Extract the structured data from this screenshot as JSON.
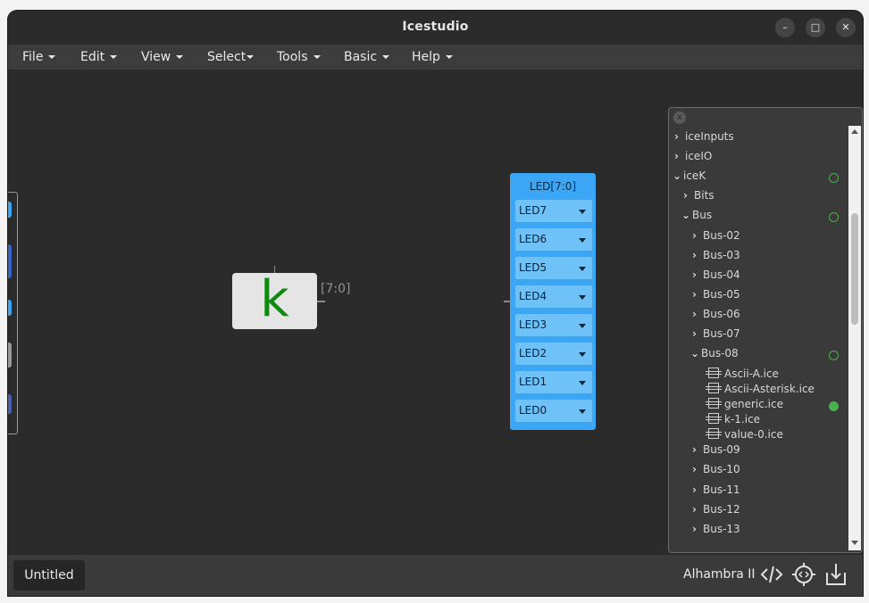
{
  "window": {
    "title": "Icestudio",
    "minimize": "–",
    "maximize": "□",
    "close": "✕"
  },
  "menubar": [
    {
      "label": "File"
    },
    {
      "label": "Edit"
    },
    {
      "label": "View"
    },
    {
      "label": "Select"
    },
    {
      "label": "Tools"
    },
    {
      "label": "Basic"
    },
    {
      "label": "Help"
    }
  ],
  "canvas": {
    "constant_block": {
      "value": "k",
      "port_label": "[7:0]"
    },
    "led_block": {
      "title": "LED[7:0]",
      "pins": [
        "LED7",
        "LED6",
        "LED5",
        "LED4",
        "LED3",
        "LED2",
        "LED1",
        "LED0"
      ]
    }
  },
  "tree": {
    "close_label": "x",
    "items": [
      {
        "label": "iceInputs",
        "state": "collapsed"
      },
      {
        "label": "iceIO",
        "state": "collapsed"
      },
      {
        "label": "iceK",
        "state": "expanded",
        "indicator": "outline"
      },
      {
        "label": "Bits",
        "state": "collapsed"
      },
      {
        "label": "Bus",
        "state": "expanded",
        "indicator": "outline"
      },
      {
        "label": "Bus-02",
        "state": "collapsed"
      },
      {
        "label": "Bus-03",
        "state": "collapsed"
      },
      {
        "label": "Bus-04",
        "state": "collapsed"
      },
      {
        "label": "Bus-05",
        "state": "collapsed"
      },
      {
        "label": "Bus-06",
        "state": "collapsed"
      },
      {
        "label": "Bus-07",
        "state": "collapsed"
      },
      {
        "label": "Bus-08",
        "state": "expanded",
        "indicator": "outline"
      },
      {
        "label": "Ascii-A.ice",
        "state": "file"
      },
      {
        "label": "Ascii-Asterisk.ice",
        "state": "file"
      },
      {
        "label": "generic.ice",
        "state": "file",
        "indicator": "filled"
      },
      {
        "label": "k-1.ice",
        "state": "file"
      },
      {
        "label": "value-0.ice",
        "state": "file"
      },
      {
        "label": "Bus-09",
        "state": "collapsed"
      },
      {
        "label": "Bus-10",
        "state": "collapsed"
      },
      {
        "label": "Bus-11",
        "state": "collapsed"
      },
      {
        "label": "Bus-12",
        "state": "collapsed"
      },
      {
        "label": "Bus-13",
        "state": "collapsed"
      }
    ]
  },
  "footer": {
    "tab_label": "Untitled",
    "board_label": "Alhambra II",
    "icons": [
      "code-icon",
      "settings-chip-icon",
      "download-icon"
    ]
  },
  "colors": {
    "accent": "#3aa6f5",
    "constant_k": "#0e8a0e",
    "indicator": "#4caf50"
  }
}
